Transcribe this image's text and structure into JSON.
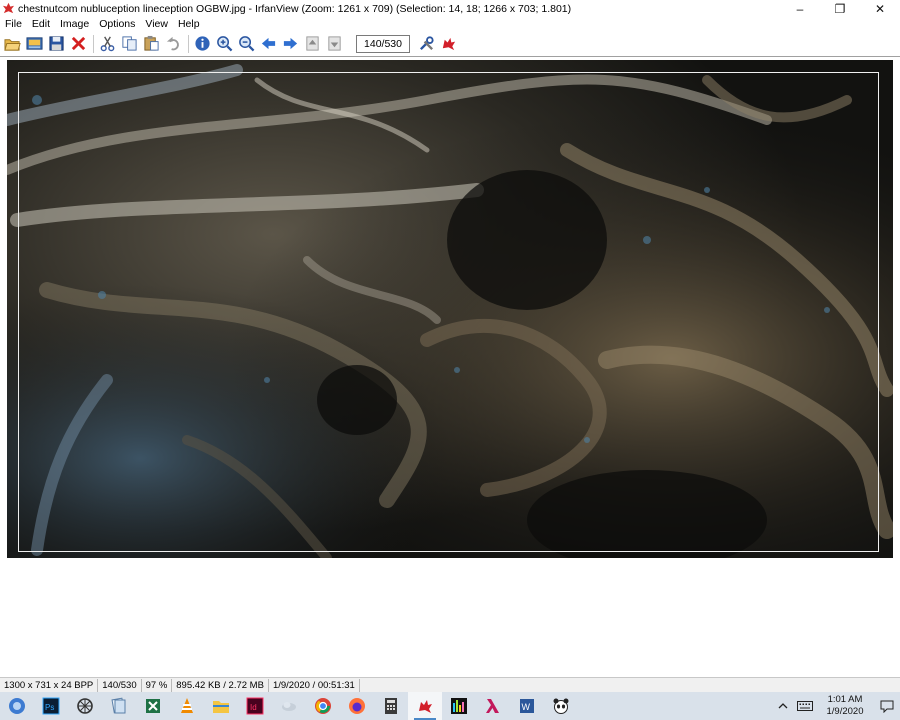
{
  "window": {
    "title": "chestnutcom nubluception lineception OGBW.jpg - IrfanView (Zoom: 1261 x 709) (Selection: 14, 18; 1266 x 703; 1.801)",
    "minimize": "–",
    "maximize": "❐",
    "close": "✕"
  },
  "menu": [
    "File",
    "Edit",
    "Image",
    "Options",
    "View",
    "Help"
  ],
  "toolbar": {
    "page_counter": "140/530"
  },
  "status": {
    "dimensions": "1300 x 731 x 24 BPP",
    "page": "140/530",
    "zoom": "97 %",
    "filesize": "895.42 KB / 2.72 MB",
    "datetime": "1/9/2020 / 00:51:31"
  },
  "taskbar": {
    "apps": [
      "orb",
      "photoshop",
      "chrome-alt",
      "files",
      "excel",
      "vlc",
      "explorer",
      "indesign",
      "cloud",
      "chrome",
      "firefox",
      "calculator",
      "irfan",
      "equalizer",
      "lambda",
      "word",
      "panda"
    ],
    "clock_time": "1:01 AM",
    "clock_date": "1/9/2020"
  },
  "colors": {
    "accent": "#4a88c7",
    "taskbar": "#d9e1ea",
    "statusbar": "#f0f0f0"
  }
}
